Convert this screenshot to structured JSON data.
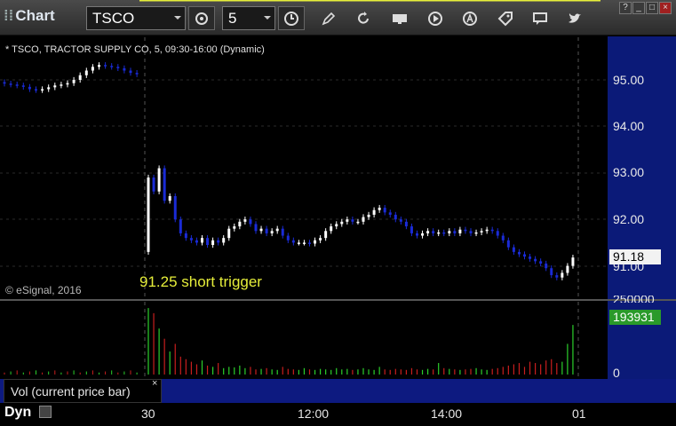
{
  "app": {
    "title": "Chart"
  },
  "toolbar": {
    "symbol": "TSCO",
    "interval": "5",
    "icons": [
      "symbol-settings-icon",
      "clock-icon",
      "pencil-draw-icon",
      "refresh-cursor-icon",
      "get-data-icon",
      "play-icon",
      "autoscale-icon",
      "tag-icon",
      "comment-icon",
      "twitter-icon"
    ]
  },
  "window_controls": [
    "?",
    "_",
    "□",
    "×"
  ],
  "chart": {
    "info": "* TSCO, TRACTOR SUPPLY CO, 5, 09:30-16:00 (Dynamic)",
    "copyright": "© eSignal, 2016",
    "annotation": "91.25 short trigger",
    "trigger_level": 91.25,
    "current_price": "91.18",
    "price_axis_labels": [
      "95.00",
      "94.00",
      "93.00",
      "92.00",
      "91.00"
    ],
    "colors": {
      "up": "#ffffff",
      "down": "#1a2bd6",
      "trigger_line": "#e6ee3a",
      "axis_bg": "#0b1a78"
    }
  },
  "volume": {
    "legend": "Vol (current price bar)",
    "close_label": "×",
    "current_value": "193931",
    "axis_labels": [
      "250000",
      "0"
    ],
    "colors": {
      "up": "#2bd02b",
      "down": "#c81e1e"
    }
  },
  "time_axis": {
    "labels": [
      "30",
      "12:00",
      "14:00",
      "01"
    ],
    "dyn_label": "Dyn"
  },
  "chart_data": {
    "type": "candlestick",
    "ylim": [
      90.6,
      95.6
    ],
    "prior_session_closes": [
      94.92,
      94.9,
      94.88,
      94.85,
      94.8,
      94.78,
      94.8,
      94.84,
      94.88,
      94.9,
      94.93,
      95.0,
      95.1,
      95.2,
      95.28,
      95.32,
      95.3,
      95.28,
      95.25,
      95.2,
      95.15,
      95.12
    ],
    "session_closes": [
      92.9,
      92.6,
      93.1,
      92.4,
      92.5,
      92.0,
      91.7,
      91.6,
      91.55,
      91.5,
      91.6,
      91.45,
      91.55,
      91.5,
      91.6,
      91.8,
      91.85,
      91.95,
      92.0,
      91.9,
      91.75,
      91.8,
      91.7,
      91.75,
      91.8,
      91.65,
      91.55,
      91.5,
      91.5,
      91.5,
      91.48,
      91.55,
      91.6,
      91.75,
      91.85,
      91.9,
      91.95,
      92.0,
      91.95,
      91.95,
      92.05,
      92.1,
      92.2,
      92.25,
      92.15,
      92.1,
      92.0,
      91.95,
      91.85,
      91.7,
      91.65,
      91.7,
      91.75,
      91.7,
      91.72,
      91.7,
      91.75,
      91.7,
      91.78,
      91.75,
      91.7,
      91.72,
      91.75,
      91.78,
      91.75,
      91.65,
      91.55,
      91.4,
      91.3,
      91.25,
      91.2,
      91.15,
      91.1,
      91.05,
      90.95,
      90.8,
      90.75,
      90.85,
      91.0,
      91.18
    ],
    "volume_session": [
      260000,
      240000,
      180000,
      140000,
      90000,
      120000,
      70000,
      60000,
      50000,
      40000,
      55000,
      35000,
      30000,
      45000,
      25000,
      30000,
      28000,
      35000,
      25000,
      30000,
      20000,
      22000,
      25000,
      20000,
      18000,
      30000,
      22000,
      20000,
      18000,
      25000,
      20000,
      18000,
      22000,
      20000,
      18000,
      25000,
      20000,
      22000,
      18000,
      20000,
      25000,
      20000,
      18000,
      30000,
      20000,
      18000,
      22000,
      20000,
      18000,
      25000,
      20000,
      18000,
      22000,
      20000,
      45000,
      25000,
      22000,
      20000,
      18000,
      20000,
      22000,
      25000,
      20000,
      18000,
      22000,
      25000,
      30000,
      35000,
      40000,
      45000,
      30000,
      50000,
      45000,
      40000,
      55000,
      60000,
      45000,
      50000,
      120000,
      193931
    ]
  }
}
